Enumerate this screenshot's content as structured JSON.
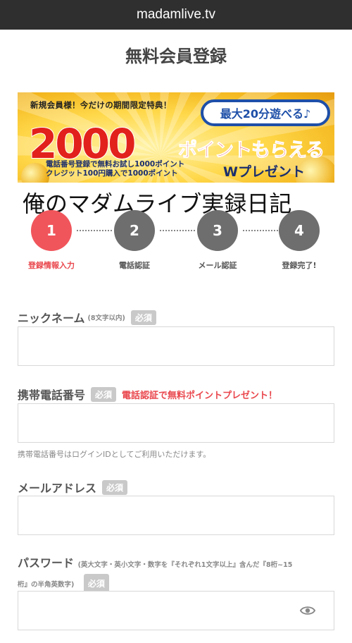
{
  "browser": {
    "url": "madamlive.tv"
  },
  "page": {
    "title": "無料会員登録"
  },
  "banner": {
    "line1": "新規会員様！今だけの期間限定特典！",
    "bubble": "最大20分遊べる♪",
    "big_number": "2000",
    "points_text": "ポイントもらえる",
    "line3a": "電話番号登録で無料お試し1000ポイント",
    "line3b": "クレジット100円購入で1000ポイント",
    "w_present": "Wプレゼント"
  },
  "overlay_text": "俺のマダムライブ実録日記",
  "steps": [
    {
      "number": "1",
      "label": "登録情報入力"
    },
    {
      "number": "2",
      "label": "電話認証"
    },
    {
      "number": "3",
      "label": "メール認証"
    },
    {
      "number": "4",
      "label": "登録完了!"
    }
  ],
  "form": {
    "required_badge": "必須",
    "nickname": {
      "label": "ニックネーム",
      "sub": "(8文字以内)",
      "value": ""
    },
    "phone": {
      "label": "携帯電話番号",
      "promo": "電話認証で無料ポイントプレゼント！",
      "hint": "携帯電話番号はログインIDとしてご利用いただけます。",
      "value": ""
    },
    "email": {
      "label": "メールアドレス",
      "value": ""
    },
    "password": {
      "label": "パスワード",
      "sub1": "(英大文字・英小文字・数字を『それぞれ1文字以上』含んだ『8桁~15",
      "sub2": "桁』の半角英数字)",
      "value": ""
    }
  },
  "colors": {
    "accent": "#f0555b",
    "step_inactive": "#6e6e6e",
    "topbar": "#2f2f2f"
  },
  "icons": {
    "password_toggle": "eye-icon"
  }
}
